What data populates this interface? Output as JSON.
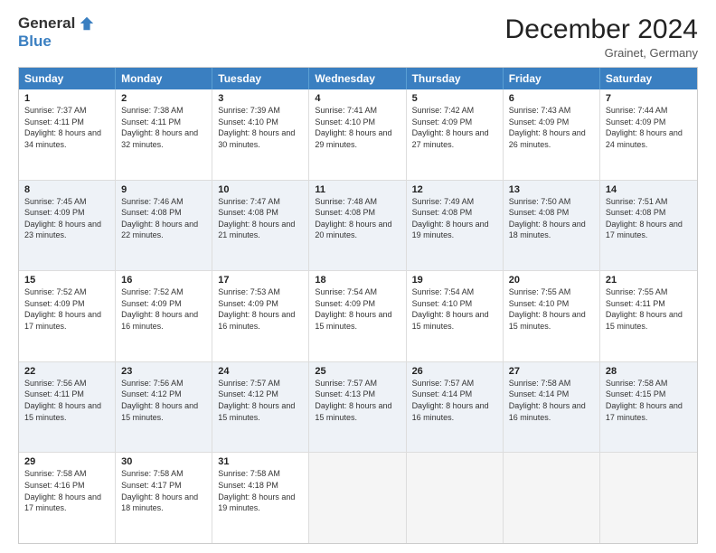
{
  "logo": {
    "general": "General",
    "blue": "Blue"
  },
  "title": "December 2024",
  "subtitle": "Grainet, Germany",
  "days": [
    "Sunday",
    "Monday",
    "Tuesday",
    "Wednesday",
    "Thursday",
    "Friday",
    "Saturday"
  ],
  "weeks": [
    [
      {
        "day": "1",
        "sunrise": "7:37 AM",
        "sunset": "4:11 PM",
        "daylight": "8 hours and 34 minutes."
      },
      {
        "day": "2",
        "sunrise": "7:38 AM",
        "sunset": "4:11 PM",
        "daylight": "8 hours and 32 minutes."
      },
      {
        "day": "3",
        "sunrise": "7:39 AM",
        "sunset": "4:10 PM",
        "daylight": "8 hours and 30 minutes."
      },
      {
        "day": "4",
        "sunrise": "7:41 AM",
        "sunset": "4:10 PM",
        "daylight": "8 hours and 29 minutes."
      },
      {
        "day": "5",
        "sunrise": "7:42 AM",
        "sunset": "4:09 PM",
        "daylight": "8 hours and 27 minutes."
      },
      {
        "day": "6",
        "sunrise": "7:43 AM",
        "sunset": "4:09 PM",
        "daylight": "8 hours and 26 minutes."
      },
      {
        "day": "7",
        "sunrise": "7:44 AM",
        "sunset": "4:09 PM",
        "daylight": "8 hours and 24 minutes."
      }
    ],
    [
      {
        "day": "8",
        "sunrise": "7:45 AM",
        "sunset": "4:09 PM",
        "daylight": "8 hours and 23 minutes."
      },
      {
        "day": "9",
        "sunrise": "7:46 AM",
        "sunset": "4:08 PM",
        "daylight": "8 hours and 22 minutes."
      },
      {
        "day": "10",
        "sunrise": "7:47 AM",
        "sunset": "4:08 PM",
        "daylight": "8 hours and 21 minutes."
      },
      {
        "day": "11",
        "sunrise": "7:48 AM",
        "sunset": "4:08 PM",
        "daylight": "8 hours and 20 minutes."
      },
      {
        "day": "12",
        "sunrise": "7:49 AM",
        "sunset": "4:08 PM",
        "daylight": "8 hours and 19 minutes."
      },
      {
        "day": "13",
        "sunrise": "7:50 AM",
        "sunset": "4:08 PM",
        "daylight": "8 hours and 18 minutes."
      },
      {
        "day": "14",
        "sunrise": "7:51 AM",
        "sunset": "4:08 PM",
        "daylight": "8 hours and 17 minutes."
      }
    ],
    [
      {
        "day": "15",
        "sunrise": "7:52 AM",
        "sunset": "4:09 PM",
        "daylight": "8 hours and 17 minutes."
      },
      {
        "day": "16",
        "sunrise": "7:52 AM",
        "sunset": "4:09 PM",
        "daylight": "8 hours and 16 minutes."
      },
      {
        "day": "17",
        "sunrise": "7:53 AM",
        "sunset": "4:09 PM",
        "daylight": "8 hours and 16 minutes."
      },
      {
        "day": "18",
        "sunrise": "7:54 AM",
        "sunset": "4:09 PM",
        "daylight": "8 hours and 15 minutes."
      },
      {
        "day": "19",
        "sunrise": "7:54 AM",
        "sunset": "4:10 PM",
        "daylight": "8 hours and 15 minutes."
      },
      {
        "day": "20",
        "sunrise": "7:55 AM",
        "sunset": "4:10 PM",
        "daylight": "8 hours and 15 minutes."
      },
      {
        "day": "21",
        "sunrise": "7:55 AM",
        "sunset": "4:11 PM",
        "daylight": "8 hours and 15 minutes."
      }
    ],
    [
      {
        "day": "22",
        "sunrise": "7:56 AM",
        "sunset": "4:11 PM",
        "daylight": "8 hours and 15 minutes."
      },
      {
        "day": "23",
        "sunrise": "7:56 AM",
        "sunset": "4:12 PM",
        "daylight": "8 hours and 15 minutes."
      },
      {
        "day": "24",
        "sunrise": "7:57 AM",
        "sunset": "4:12 PM",
        "daylight": "8 hours and 15 minutes."
      },
      {
        "day": "25",
        "sunrise": "7:57 AM",
        "sunset": "4:13 PM",
        "daylight": "8 hours and 15 minutes."
      },
      {
        "day": "26",
        "sunrise": "7:57 AM",
        "sunset": "4:14 PM",
        "daylight": "8 hours and 16 minutes."
      },
      {
        "day": "27",
        "sunrise": "7:58 AM",
        "sunset": "4:14 PM",
        "daylight": "8 hours and 16 minutes."
      },
      {
        "day": "28",
        "sunrise": "7:58 AM",
        "sunset": "4:15 PM",
        "daylight": "8 hours and 17 minutes."
      }
    ],
    [
      {
        "day": "29",
        "sunrise": "7:58 AM",
        "sunset": "4:16 PM",
        "daylight": "8 hours and 17 minutes."
      },
      {
        "day": "30",
        "sunrise": "7:58 AM",
        "sunset": "4:17 PM",
        "daylight": "8 hours and 18 minutes."
      },
      {
        "day": "31",
        "sunrise": "7:58 AM",
        "sunset": "4:18 PM",
        "daylight": "8 hours and 19 minutes."
      },
      null,
      null,
      null,
      null
    ]
  ]
}
